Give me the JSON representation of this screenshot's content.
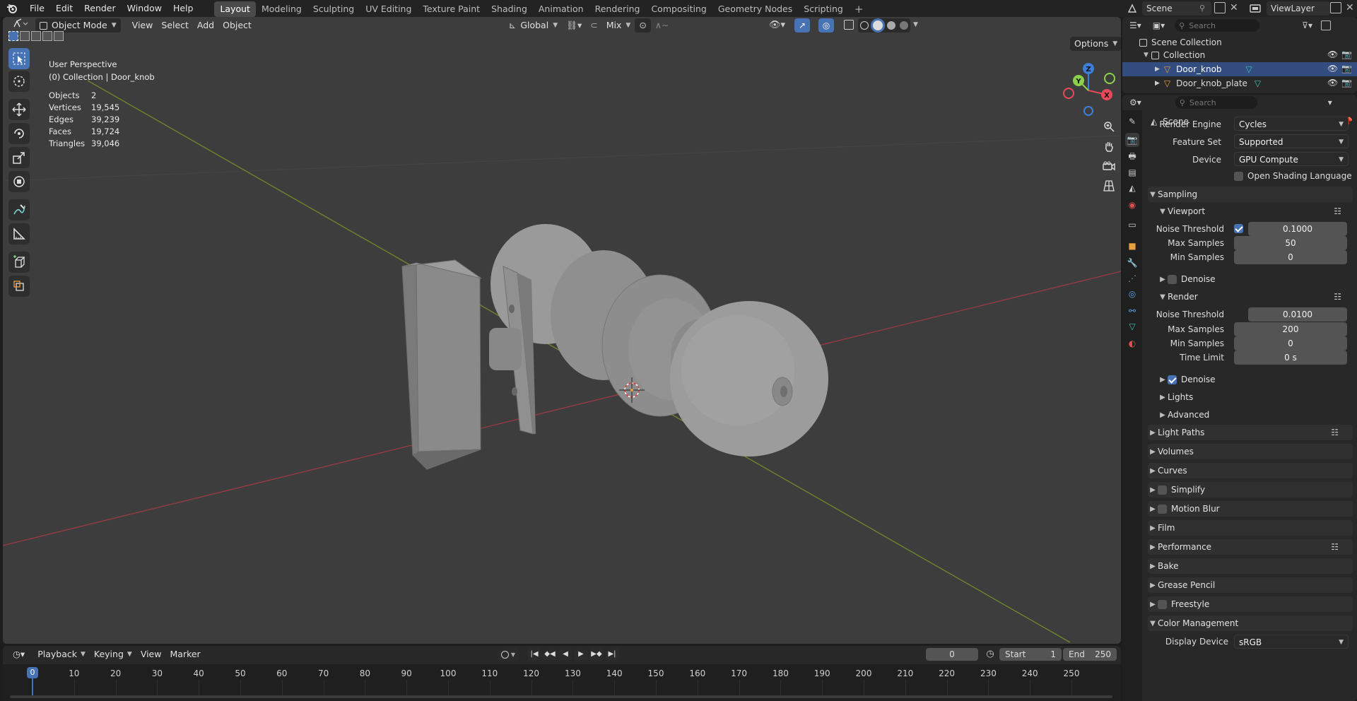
{
  "topbar": {
    "menus": [
      "File",
      "Edit",
      "Render",
      "Window",
      "Help"
    ],
    "workspaces": [
      "Layout",
      "Modeling",
      "Sculpting",
      "UV Editing",
      "Texture Paint",
      "Shading",
      "Animation",
      "Rendering",
      "Compositing",
      "Geometry Nodes",
      "Scripting"
    ],
    "active_workspace": "Layout",
    "add_tab": "+",
    "scene_name": "Scene",
    "view_layer": "ViewLayer"
  },
  "viewport": {
    "mode": "Object Mode",
    "menus": [
      "View",
      "Select",
      "Add",
      "Object"
    ],
    "orientation": "Global",
    "snap_mode": "Mix",
    "options_label": "Options",
    "perspective": "User Perspective",
    "collection_info": "(0) Collection | Door_knob",
    "stats": [
      {
        "label": "Objects",
        "value": "2"
      },
      {
        "label": "Vertices",
        "value": "19,545"
      },
      {
        "label": "Edges",
        "value": "39,239"
      },
      {
        "label": "Faces",
        "value": "19,724"
      },
      {
        "label": "Triangles",
        "value": "39,046"
      }
    ],
    "gizmo": {
      "x": "X",
      "y": "Y",
      "z": "Z"
    },
    "colors": {
      "x_axis": "#e64a5a",
      "y_axis": "#8bd14a",
      "z_axis": "#3d7fd8",
      "background": "#3d3d3d"
    }
  },
  "timeline": {
    "menus": [
      "Playback",
      "Keying",
      "View",
      "Marker"
    ],
    "current_frame": "0",
    "start_label": "Start",
    "start_value": "1",
    "end_label": "End",
    "end_value": "250",
    "ticks": [
      "0",
      "10",
      "20",
      "30",
      "40",
      "50",
      "60",
      "70",
      "80",
      "90",
      "100",
      "110",
      "120",
      "130",
      "140",
      "150",
      "160",
      "170",
      "180",
      "190",
      "200",
      "210",
      "220",
      "230",
      "240",
      "250"
    ]
  },
  "outliner": {
    "search_placeholder": "Search",
    "scene_collection": "Scene Collection",
    "collection": "Collection",
    "objects": [
      "Door_knob",
      "Door_knob_plate"
    ]
  },
  "properties": {
    "search_placeholder": "Search",
    "context": "Scene",
    "render_engine_label": "Render Engine",
    "render_engine": "Cycles",
    "feature_set_label": "Feature Set",
    "feature_set": "Supported",
    "device_label": "Device",
    "device": "GPU Compute",
    "osl_label": "Open Shading Language",
    "sampling": "Sampling",
    "viewport_sub": "Viewport",
    "noise_threshold_label": "Noise Threshold",
    "vp_noise_threshold": "0.1000",
    "max_samples_label": "Max Samples",
    "vp_max_samples": "50",
    "min_samples_label": "Min Samples",
    "vp_min_samples": "0",
    "denoise_label": "Denoise",
    "render_sub": "Render",
    "r_noise_threshold": "0.0100",
    "r_max_samples": "200",
    "r_min_samples": "0",
    "time_limit_label": "Time Limit",
    "r_time_limit": "0 s",
    "lights": "Lights",
    "advanced": "Advanced",
    "panels": [
      "Light Paths",
      "Volumes",
      "Curves",
      "Simplify",
      "Motion Blur",
      "Film",
      "Performance",
      "Bake",
      "Grease Pencil",
      "Freestyle",
      "Color Management"
    ],
    "display_device_label": "Display Device",
    "display_device": "sRGB"
  }
}
